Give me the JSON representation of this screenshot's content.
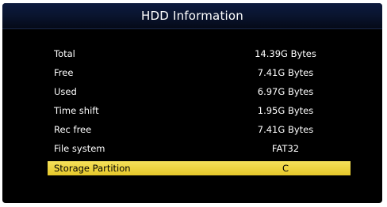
{
  "window": {
    "title": "HDD Information"
  },
  "info_rows": [
    {
      "label": "Total",
      "value": "14.39G Bytes"
    },
    {
      "label": "Free",
      "value": "7.41G Bytes"
    },
    {
      "label": "Used",
      "value": "6.97G Bytes"
    },
    {
      "label": "Time shift",
      "value": "1.95G Bytes"
    },
    {
      "label": "Rec free",
      "value": "7.41G Bytes"
    },
    {
      "label": "File system",
      "value": "FAT32"
    },
    {
      "label": "Storage Partition",
      "value": "C",
      "selected": true
    }
  ],
  "colors": {
    "background": "#000000",
    "title_bar": "#0a1530",
    "highlight": "#eed23a",
    "text": "#ffffff",
    "highlight_text": "#000000"
  }
}
